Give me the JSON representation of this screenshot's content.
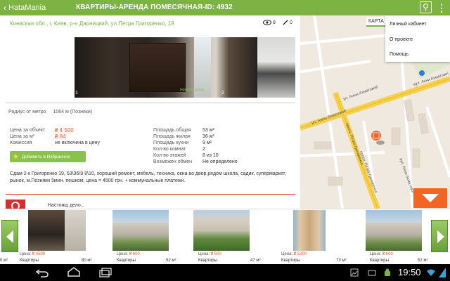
{
  "header": {
    "logo_chevron": "‹",
    "app_name": "HataMania",
    "title": "КВАРТИРЫ-АРЕНДА ПОМЕСЯЧНАЯ-ID: 4932",
    "menu_dots": "⋮"
  },
  "listing": {
    "address": "Киевская обл., г. Киев, р-н Дарницкий, ул.Петра Григоренко, 19",
    "views_count": "8",
    "edits_count": "0",
    "photo_1_num": "1",
    "photo_2_num": "2",
    "photo_watermark": "HataMania",
    "radius_label": "Радиус от метро",
    "radius_value": "1064 м (Позняки)",
    "left_details": [
      {
        "label": "Цена за объект",
        "value": "₴ 4 500",
        "orange": true
      },
      {
        "label": "Цена за м²",
        "value": "₴ 84",
        "orange": true
      },
      {
        "label": "Комиссия",
        "value": "не включена в цену",
        "orange": false
      }
    ],
    "right_details": [
      {
        "label": "Площадь общая",
        "value": "53 м²"
      },
      {
        "label": "Площадь жилая",
        "value": "36 м²"
      },
      {
        "label": "Площадь кухни",
        "value": "9 м²"
      },
      {
        "label": "Кол-во комнат",
        "value": "2"
      },
      {
        "label": "Кол-во этажей",
        "value": "8 из 10"
      },
      {
        "label": "Возможен обмен",
        "value": "Не определено"
      }
    ],
    "favorite_button": "Добавить в Избранное",
    "description": "Сдам 2-к Григоренко 19, 53\\36\\9 8\\10, хороший ремонт, мебель, техника, окна во двор,рядом школа, садик, супермаркет, рынок, м.Позняки 5мин. пешком, цена = 4500 грн. + коммунальные платежи.",
    "under_text": "Настоящ дело..."
  },
  "map": {
    "tab_label": "КАРТА",
    "labels": [
      "ул. Анны Ахматовой",
      "ул. Анны Ахматовой",
      "просп. Петра Григоренко",
      "просп. Петра Григоренко",
      "вул. Анни Ахматової",
      "вул. Анни Ахматової"
    ],
    "colors": {
      "road_major": "#f7d14c",
      "road_minor": "#ffffff",
      "background": "#efe9e0",
      "marker": "#f26522"
    }
  },
  "dropdown": {
    "items": [
      "Личный кабинет",
      "О проекте",
      "Помощь"
    ]
  },
  "thumbnails": [
    {
      "price_label": "Цена:",
      "price": "₴ 4500",
      "type": "Квартиры",
      "area_left": "0 м²",
      "area": "80 м²"
    },
    {
      "price_label": "Цена:",
      "price": "₴ 600",
      "type": "Квартиры",
      "area": "52 м²"
    },
    {
      "price_label": "Цена:",
      "price": "₴ 500",
      "type": "Квартиры",
      "area": "47 м²"
    },
    {
      "price_label": "Цена:",
      "price": "₴ 5200",
      "type": "Квартиры",
      "area": "73 м²"
    },
    {
      "price_label": "Цена:",
      "price": "₴ 600",
      "type": "Квартиры",
      "area": "52 м²"
    }
  ],
  "system": {
    "clock": "19:50"
  },
  "colors": {
    "accent": "#7cb342",
    "price": "#f05a28",
    "cta": "#f26522"
  }
}
